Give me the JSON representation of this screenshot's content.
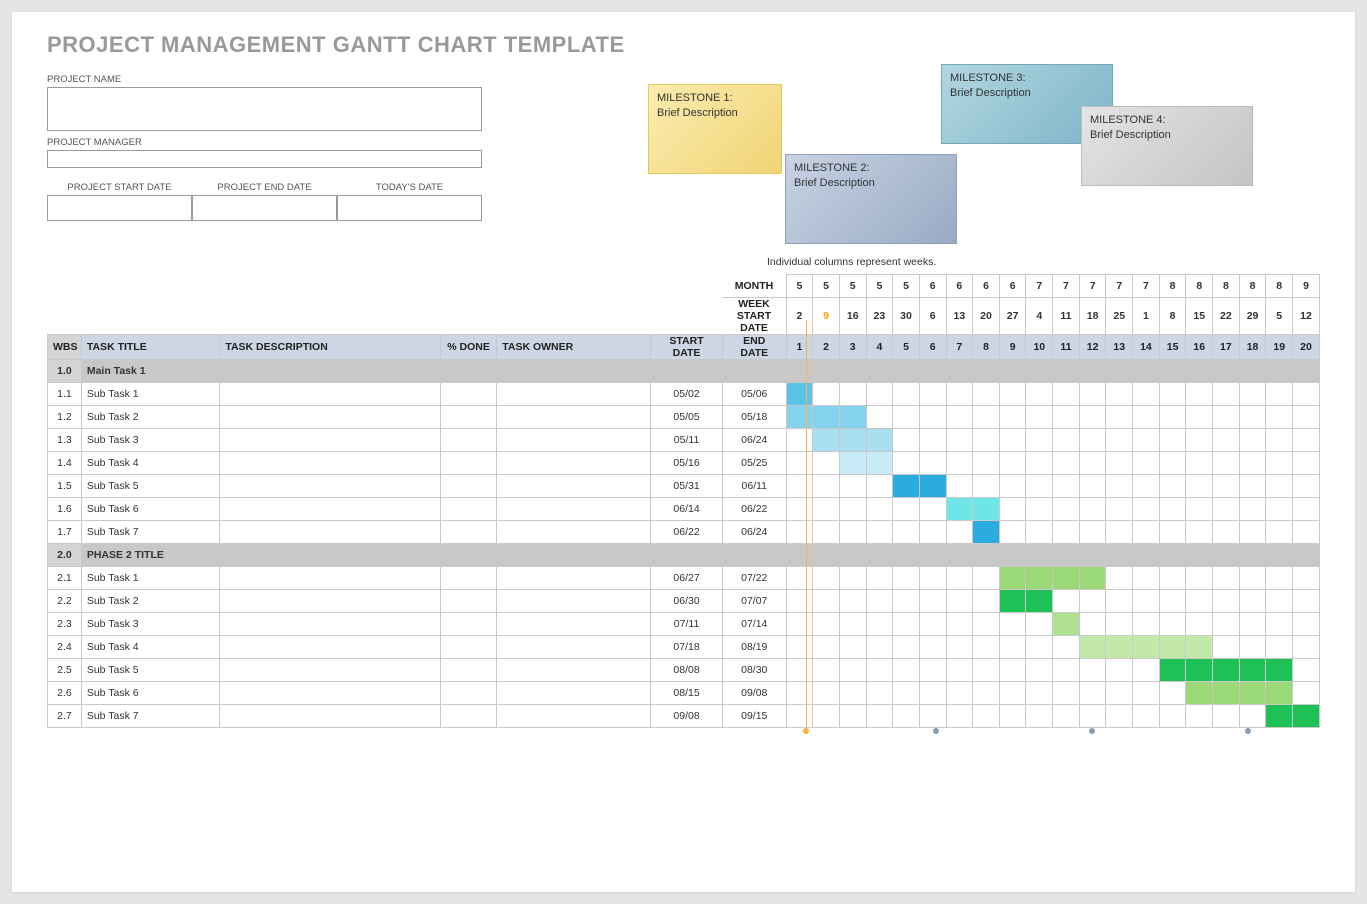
{
  "title": "PROJECT MANAGEMENT GANTT CHART TEMPLATE",
  "labels": {
    "project_name": "PROJECT NAME",
    "project_manager": "PROJECT MANAGER",
    "start_date": "PROJECT START DATE",
    "end_date": "PROJECT END DATE",
    "todays_date": "TODAY'S DATE",
    "month": "MONTH",
    "week_start": "WEEK START DATE",
    "note": "Individual columns represent weeks."
  },
  "milestones": [
    {
      "title": "MILESTONE 1:",
      "desc": "Brief Description"
    },
    {
      "title": "MILESTONE 2:",
      "desc": "Brief Description"
    },
    {
      "title": "MILESTONE 3:",
      "desc": "Brief Description"
    },
    {
      "title": "MILESTONE 4:",
      "desc": "Brief Description"
    }
  ],
  "columns": {
    "wbs": "WBS",
    "title": "TASK TITLE",
    "desc": "TASK DESCRIPTION",
    "done": "% DONE",
    "owner": "TASK OWNER",
    "start": "START DATE",
    "end": "END DATE"
  },
  "chart_data": {
    "type": "gantt",
    "weeks": 20,
    "today_week": 2,
    "milestone_markers": [
      7,
      13,
      19
    ],
    "month_row": [
      "5",
      "5",
      "5",
      "5",
      "5",
      "6",
      "6",
      "6",
      "6",
      "7",
      "7",
      "7",
      "7",
      "7",
      "8",
      "8",
      "8",
      "8",
      "8",
      "9",
      "9"
    ],
    "week_start_row": [
      "2",
      "9",
      "16",
      "23",
      "30",
      "6",
      "13",
      "20",
      "27",
      "4",
      "11",
      "18",
      "25",
      "1",
      "8",
      "15",
      "22",
      "29",
      "5",
      "12"
    ],
    "week_index_row": [
      "1",
      "2",
      "3",
      "4",
      "5",
      "6",
      "7",
      "8",
      "9",
      "10",
      "11",
      "12",
      "13",
      "14",
      "15",
      "16",
      "17",
      "18",
      "19",
      "20"
    ],
    "groups": [
      {
        "wbs": "1.0",
        "title": "Main Task 1",
        "tasks": [
          {
            "wbs": "1.1",
            "title": "Sub Task 1",
            "start": "05/02",
            "end": "05/06",
            "bar_start": 1,
            "bar_end": 1,
            "color": "c-skyA"
          },
          {
            "wbs": "1.2",
            "title": "Sub Task 2",
            "start": "05/05",
            "end": "05/18",
            "bar_start": 1,
            "bar_end": 3,
            "color": "c-skyB"
          },
          {
            "wbs": "1.3",
            "title": "Sub Task 3",
            "start": "05/11",
            "end": "06/24",
            "bar_start": 2,
            "bar_end": 4,
            "color": "c-skyC"
          },
          {
            "wbs": "1.4",
            "title": "Sub Task 4",
            "start": "05/16",
            "end": "05/25",
            "bar_start": 3,
            "bar_end": 4,
            "color": "c-skyD"
          },
          {
            "wbs": "1.5",
            "title": "Sub Task 5",
            "start": "05/31",
            "end": "06/11",
            "bar_start": 5,
            "bar_end": 6,
            "color": "c-skyDk"
          },
          {
            "wbs": "1.6",
            "title": "Sub Task 6",
            "start": "06/14",
            "end": "06/22",
            "bar_start": 7,
            "bar_end": 8,
            "color": "c-cyan"
          },
          {
            "wbs": "1.7",
            "title": "Sub Task 7",
            "start": "06/22",
            "end": "06/24",
            "bar_start": 8,
            "bar_end": 8,
            "color": "c-skyDk"
          }
        ]
      },
      {
        "wbs": "2.0",
        "title": "PHASE 2 TITLE",
        "tasks": [
          {
            "wbs": "2.1",
            "title": "Sub Task 1",
            "start": "06/27",
            "end": "07/22",
            "bar_start": 9,
            "bar_end": 12,
            "color": "c-grB"
          },
          {
            "wbs": "2.2",
            "title": "Sub Task 2",
            "start": "06/30",
            "end": "07/07",
            "bar_start": 9,
            "bar_end": 10,
            "color": "c-grDk"
          },
          {
            "wbs": "2.3",
            "title": "Sub Task 3",
            "start": "07/11",
            "end": "07/14",
            "bar_start": 11,
            "bar_end": 11,
            "color": "c-grC"
          },
          {
            "wbs": "2.4",
            "title": "Sub Task 4",
            "start": "07/18",
            "end": "08/19",
            "bar_start": 12,
            "bar_end": 16,
            "color": "c-grD"
          },
          {
            "wbs": "2.5",
            "title": "Sub Task 5",
            "start": "08/08",
            "end": "08/30",
            "bar_start": 15,
            "bar_end": 19,
            "color": "c-grDk"
          },
          {
            "wbs": "2.6",
            "title": "Sub Task 6",
            "start": "08/15",
            "end": "09/08",
            "bar_start": 16,
            "bar_end": 19,
            "color": "c-grB"
          },
          {
            "wbs": "2.7",
            "title": "Sub Task 7",
            "start": "09/08",
            "end": "09/15",
            "bar_start": 19,
            "bar_end": 20,
            "color": "c-grDk"
          }
        ]
      }
    ]
  }
}
